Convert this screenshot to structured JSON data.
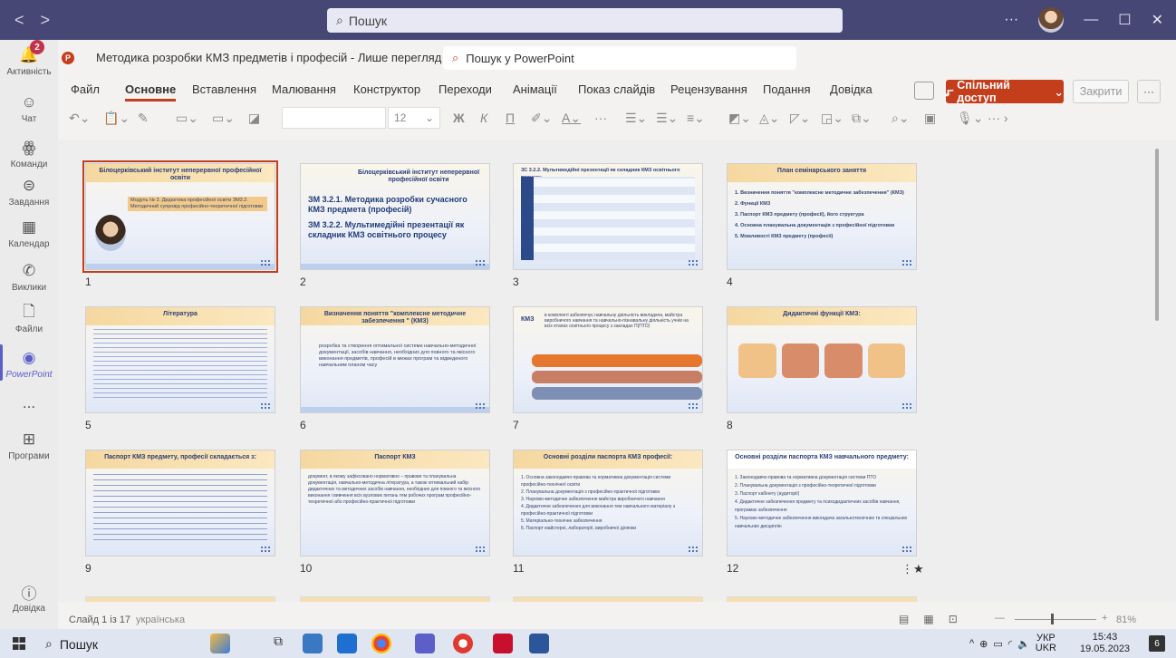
{
  "teams": {
    "search_placeholder": "Пошук",
    "rail": [
      {
        "label": "Активність",
        "icon": "bell-icon",
        "badge": "2"
      },
      {
        "label": "Чат",
        "icon": "chat-icon"
      },
      {
        "label": "Команди",
        "icon": "teams-icon"
      },
      {
        "label": "Завдання",
        "icon": "tasks-icon"
      },
      {
        "label": "Календар",
        "icon": "calendar-icon"
      },
      {
        "label": "Виклики",
        "icon": "phone-icon"
      },
      {
        "label": "Файли",
        "icon": "files-icon"
      },
      {
        "label": "PowerPoint",
        "icon": "powerpoint-icon",
        "active": true
      },
      {
        "label": "...",
        "icon": "more-icon"
      },
      {
        "label": "Програми",
        "icon": "apps-icon"
      },
      {
        "label": "Довідка",
        "icon": "help-icon"
      }
    ]
  },
  "powerpoint": {
    "doc_title": "Методика розробки КМЗ предметів і професій - Лише перегляд ⌄",
    "search_placeholder": "Пошук у PowerPoint",
    "menu": [
      "Файл",
      "Основне",
      "Вставлення",
      "Малювання",
      "Конструктор",
      "Переходи",
      "Анімації",
      "Показ слайдів",
      "Рецензування",
      "Подання",
      "Довідка"
    ],
    "active_tab": "Основне",
    "share_label": "Спільний доступ",
    "close_label": "Закрити",
    "font_size": "12",
    "accent": "#c43e1c"
  },
  "slides": [
    {
      "n": "1",
      "title": "Білоцерківський інститут неперервної професійної освіти",
      "text": "Модуль № 3. Дидактика професійної освіти ЗМ3.2. Методичний супровід професійно-теоретичної підготовки"
    },
    {
      "n": "2",
      "title": "Білоцерківський інститут неперервної професійної освіти",
      "text": "ЗМ 3.2.1. Методика розробки сучасного КМЗ предмета (професій)",
      "text2": "ЗМ 3.2.2. Мультимедійні презентації як складник КМЗ освітнього процесу"
    },
    {
      "n": "3",
      "title": "ЗС 3.2.2. Мультимедійні презентації як складник КМЗ освітнього процесу"
    },
    {
      "n": "4",
      "title": "План семінарського заняття",
      "items": [
        "1. Визначення поняття \"комплексне методичне забезпечення\" (КМЗ)",
        "2. Функції КМЗ",
        "3. Паспорт КМЗ предмету (професії), його структура",
        "4. Основна планувальна документація з професійної підготовки",
        "5. Можливості КМЗ предмету (професії)"
      ]
    },
    {
      "n": "5",
      "title": "Література"
    },
    {
      "n": "6",
      "title": "Визначення поняття \"комплексне методичне забезпечення \" (КМЗ)",
      "text": "розробка та створення оптимальної системи навчально-методичної документації, засобів навчання, необхідних для повного та якісного виконання предметів, професій в межах програм та відведеного навчальним планом часу"
    },
    {
      "n": "7",
      "title": "КМЗ",
      "text": "в комплекті забезпечує навчальну діяльність викладача, майстра виробничого навчання та навчально-пізнавальну діяльність учнів на всіх етапах освітнього процесу з закладах П(ПТО)"
    },
    {
      "n": "8",
      "title": "Дидактичні функції КМЗ:"
    },
    {
      "n": "9",
      "title": "Паспорт КМЗ предмету, професії складається з:"
    },
    {
      "n": "10",
      "title": "Паспорт КМЗ",
      "text": "документ, в якому зафіксовано нормативно – правове та планувальна документація, навчально-методична література, а також оптимальний набір дидактичних та методичних засобів навчання, необхідних для повного та якісного виконання і вивчення всіх вузлових питань тем робочих програм професійно-теоретичної або професійно-практичної підготовки"
    },
    {
      "n": "11",
      "title": "Основні розділи паспорта КМЗ професії:",
      "items": [
        "1. Основна законодавчо-правова та нормативна документація системи професійно-технічної освіти",
        "2. Планувальна документація з професійно-практичної підготовки",
        "3. Науково-методичне забезпечення майстра виробничого навчання",
        "4. Дидактичне забезпечення для виконання тем навчального матеріалу з професійно-практичної підготовки",
        "5. Матеріально-технічне забезпечення",
        "6. Паспорт майстерні, лабораторії, виробничої ділянки"
      ]
    },
    {
      "n": "12",
      "title": "Основні розділи паспорта КМЗ навчального предмету:",
      "items": [
        "1. Законодавчо-правова та нормативна документація системи ПТО",
        "2. Планувальна документація з професійно-теоретичної підготовки",
        "3. Паспорт кабінету (аудиторії)",
        "4. Дидактичне забезпечення предмету та психодидактичних засобів навчання, програмах забезпечення",
        "5. Науково-методичне забезпечення викладача загальнотехнічних та спеціальних навчальних дисциплін"
      ]
    }
  ],
  "star": "⋮★",
  "status": {
    "slide": "Слайд 1 із 17",
    "language": "українська",
    "zoom": "81%"
  },
  "taskbar": {
    "search": "Пошук",
    "lang": "УКР",
    "lang2": "UKR",
    "time": "15:43",
    "date": "19.05.2023",
    "notifications": "6"
  }
}
